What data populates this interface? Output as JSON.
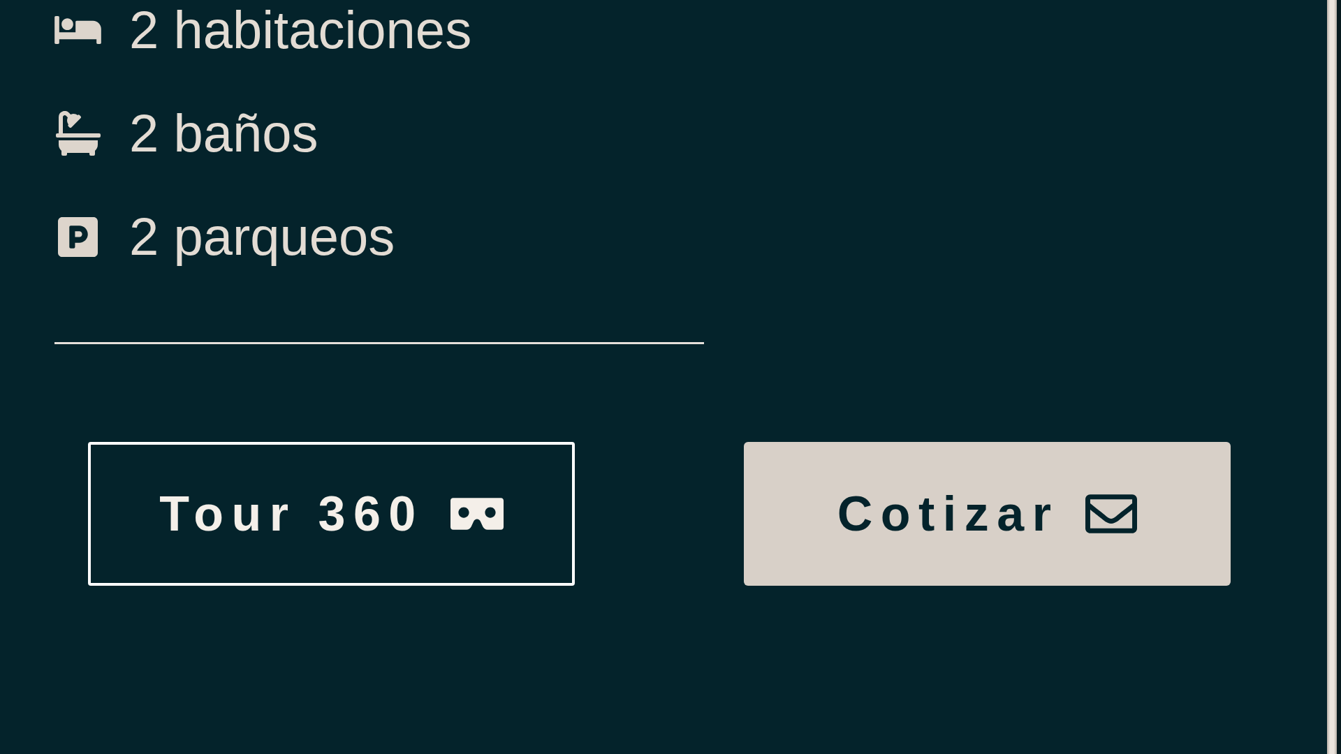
{
  "features": [
    {
      "kind": "bedrooms",
      "text": "2 habitaciones"
    },
    {
      "kind": "bathrooms",
      "text": "2 baños"
    },
    {
      "kind": "parking",
      "text": "2 parqueos"
    }
  ],
  "actions": [
    {
      "kind": "tour",
      "label": "Tour 360"
    },
    {
      "kind": "quote",
      "label": "Cotizar"
    }
  ]
}
